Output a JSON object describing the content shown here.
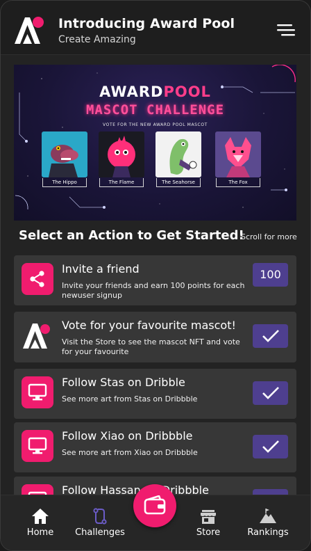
{
  "header": {
    "title": "Introducing Award Pool",
    "subtitle": "Create Amazing",
    "logo_icon": "award-pool-logo",
    "menu_icon": "hamburger-menu-icon"
  },
  "banner": {
    "brand_award": "AWARD",
    "brand_pool": "POOL",
    "title": "MASCOT CHALLENGE",
    "vote_text": "VOTE FOR THE NEW AWARD POOL MASCOT",
    "cards": [
      {
        "label": "The Hippo"
      },
      {
        "label": "The Flame"
      },
      {
        "label": "The Seahorse"
      },
      {
        "label": "The Fox"
      }
    ]
  },
  "section": {
    "title": "Select an Action to Get Started!",
    "scroll_hint": "Scroll for more"
  },
  "actions": [
    {
      "title": "Invite a friend",
      "desc": "Invite your friends and earn 100 points for each newuser signup",
      "icon": "share-icon",
      "badge": "100"
    },
    {
      "title": "Vote for your favourite mascot!",
      "desc": "Visit the Store to see the mascot NFT and vote for your favourite",
      "icon": "award-pool-logo",
      "status": "done"
    },
    {
      "title": "Follow Stas on Dribble",
      "desc": "See more art from Stas on Dribbble",
      "icon": "monitor-icon",
      "status": "done"
    },
    {
      "title": "Follow Xiao on Dribbble",
      "desc": "See more art from Xiao on Dribbble",
      "icon": "monitor-icon",
      "status": "done"
    },
    {
      "title": "Follow Hassan on Dribbble",
      "desc": "",
      "icon": "monitor-icon",
      "status": "done"
    }
  ],
  "nav": {
    "home": "Home",
    "challenges": "Challenges",
    "store": "Store",
    "rankings": "Rankings",
    "fab_icon": "wallet-icon"
  },
  "colors": {
    "accent": "#f01c6e",
    "badge": "#4e3f8f",
    "card_bg": "#373737",
    "background": "#232323"
  }
}
